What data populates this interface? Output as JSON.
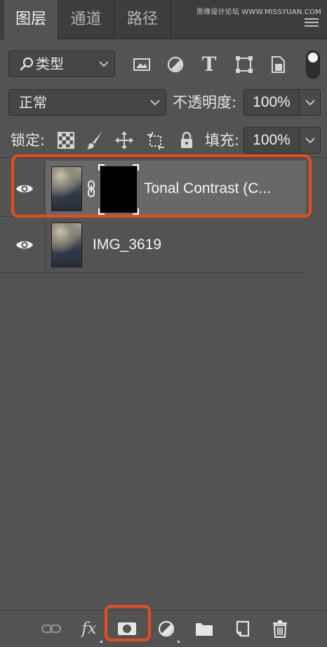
{
  "tabs": [
    {
      "label": "图层"
    },
    {
      "label": "通道"
    },
    {
      "label": "路径"
    }
  ],
  "watermark": "思缘设计论坛 WWW.MISSYUAN.COM",
  "filter": {
    "kind_label": "类型",
    "icons": [
      "image-filter-icon",
      "adjustment-filter-icon",
      "type-filter-icon",
      "shape-filter-icon",
      "smart-object-filter-icon"
    ],
    "type_glyph": "T"
  },
  "blend": {
    "mode": "正常",
    "opacity_label": "不透明度:",
    "opacity_value": "100%"
  },
  "lock": {
    "label": "锁定:",
    "fill_label": "填充:",
    "fill_value": "100%"
  },
  "layers": [
    {
      "name": "Tonal Contrast (C...",
      "visible": true,
      "selected": true,
      "has_mask": true
    },
    {
      "name": "IMG_3619",
      "visible": true,
      "selected": false,
      "has_mask": false
    }
  ],
  "bottom": {
    "fx_label": "fx",
    "icons": [
      "link-layers-icon",
      "fx-icon",
      "add-mask-icon",
      "new-adjustment-icon",
      "new-group-icon",
      "new-layer-icon",
      "trash-icon"
    ]
  },
  "colors": {
    "panel_bg": "#535353",
    "tab_bar_bg": "#3d3d3d",
    "selected_row": "#686868",
    "highlight": "#ea4b1e"
  }
}
